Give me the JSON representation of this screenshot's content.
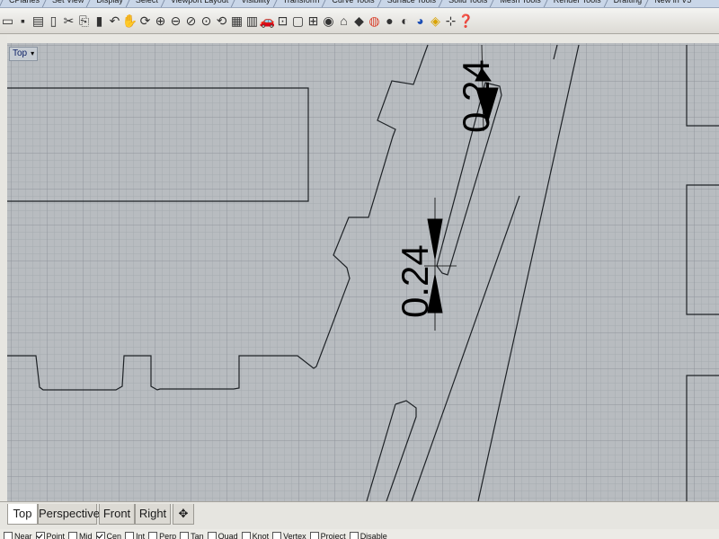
{
  "toolbar_tabs": [
    "CPlanes",
    "Set View",
    "Display",
    "Select",
    "Viewport Layout",
    "Visibility",
    "Transform",
    "Curve Tools",
    "Surface Tools",
    "Solid Tools",
    "Mesh Tools",
    "Render Tools",
    "Drafting",
    "New in V5"
  ],
  "toolbar_icons": [
    "new-file-icon",
    "save-icon",
    "print-icon",
    "import-icon",
    "cut-icon",
    "copy-icon",
    "paste-icon",
    "undo-icon",
    "pan-icon",
    "rotate-view-icon",
    "zoom-window-icon",
    "zoom-extents-icon",
    "zoom-selected-icon",
    "zoom-dynamic-icon",
    "undo-view-icon",
    "four-viewports-icon",
    "grid-icon",
    "car-icon",
    "select-points-icon",
    "rectangle-select-icon",
    "cplane-icon",
    "light-icon",
    "lock-icon",
    "material-icon",
    "color-circle-icon",
    "render-sphere-icon",
    "shaded-sphere-icon",
    "rendered-sphere-icon",
    "gumball-icon",
    "osnap-icon",
    "help-icon"
  ],
  "viewport": {
    "label": "Top"
  },
  "dimensions": {
    "upper": "0.24",
    "lower": "0.24"
  },
  "viewport_tabs": [
    "Top",
    "Perspective",
    "Front",
    "Right"
  ],
  "osnap": [
    {
      "label": "Near",
      "checked": false
    },
    {
      "label": "Point",
      "checked": true
    },
    {
      "label": "Mid",
      "checked": false
    },
    {
      "label": "Cen",
      "checked": true
    },
    {
      "label": "Int",
      "checked": false
    },
    {
      "label": "Perp",
      "checked": false
    },
    {
      "label": "Tan",
      "checked": false
    },
    {
      "label": "Quad",
      "checked": false
    },
    {
      "label": "Knot",
      "checked": false
    },
    {
      "label": "Vertex",
      "checked": false
    },
    {
      "label": "Project",
      "checked": false
    },
    {
      "label": "Disable",
      "checked": false
    }
  ],
  "colors": {
    "grid_bg": "#b8bcc0",
    "grid_minor": "#a6abb0",
    "grid_major": "#8f959b",
    "curve": "#1e2226",
    "label_text": "#0a1f66"
  }
}
